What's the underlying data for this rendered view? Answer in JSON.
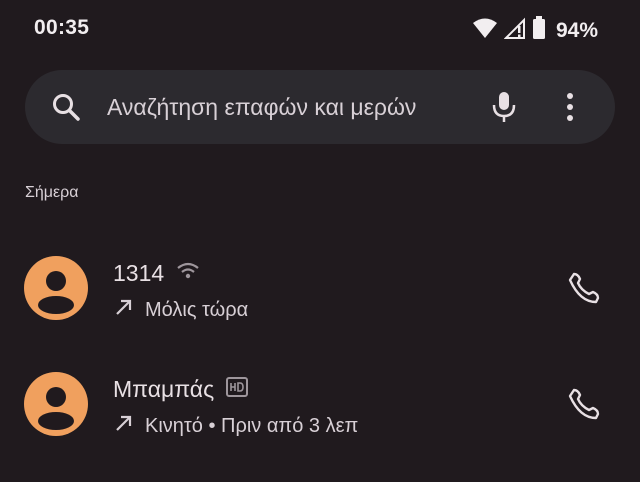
{
  "status_bar": {
    "time": "00:35",
    "battery_percent": "94%",
    "icons": [
      "wifi-icon",
      "cellular-signal-icon",
      "battery-icon"
    ]
  },
  "search": {
    "placeholder": "Αναζήτηση επαφών και μερών",
    "icons": [
      "search-icon",
      "microphone-icon",
      "more-vert-icon"
    ]
  },
  "recents": {
    "section_title": "Σήμερα",
    "calls": [
      {
        "name": "1314",
        "badge_icon": "wifi-calling-icon",
        "direction_icon": "outgoing-call-icon",
        "detail": "Μόλις τώρα",
        "action_icon": "phone-icon"
      },
      {
        "name": "Μπαμπάς",
        "badge_icon": "hd-icon",
        "direction_icon": "outgoing-call-icon",
        "detail": "Κινητό • Πριν από 3 λεπ",
        "action_icon": "phone-icon"
      }
    ]
  },
  "colors": {
    "background": "#201a1e",
    "search_background": "#2c2a2f",
    "avatar": "#f0a05e",
    "text_primary": "#e8e0e4",
    "text_secondary": "#d8d0d6"
  }
}
